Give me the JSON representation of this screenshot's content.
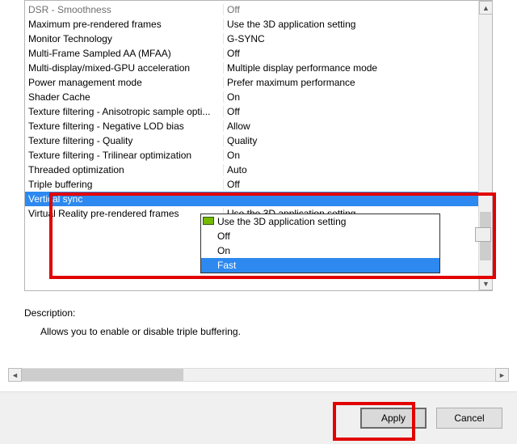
{
  "settings_grid": {
    "rows": [
      {
        "feature": "DSR - Smoothness",
        "value": "Off",
        "muted": true
      },
      {
        "feature": "Maximum pre-rendered frames",
        "value": "Use the 3D application setting"
      },
      {
        "feature": "Monitor Technology",
        "value": "G-SYNC"
      },
      {
        "feature": "Multi-Frame Sampled AA (MFAA)",
        "value": "Off"
      },
      {
        "feature": "Multi-display/mixed-GPU acceleration",
        "value": "Multiple display performance mode"
      },
      {
        "feature": "Power management mode",
        "value": "Prefer maximum performance"
      },
      {
        "feature": "Shader Cache",
        "value": "On"
      },
      {
        "feature": "Texture filtering - Anisotropic sample opti...",
        "value": "Off"
      },
      {
        "feature": "Texture filtering - Negative LOD bias",
        "value": "Allow"
      },
      {
        "feature": "Texture filtering - Quality",
        "value": "Quality"
      },
      {
        "feature": "Texture filtering - Trilinear optimization",
        "value": "On"
      },
      {
        "feature": "Threaded optimization",
        "value": "Auto"
      },
      {
        "feature": "Triple buffering",
        "value": "Off"
      },
      {
        "feature": "Vertical sync",
        "value": "Fast",
        "selected": true
      },
      {
        "feature": "Virtual Reality pre-rendered frames",
        "value": "Use the 3D application setting"
      }
    ]
  },
  "dropdown": {
    "selected": "Fast",
    "options": [
      {
        "label": "Use the 3D application setting",
        "nvidia_icon": true
      },
      {
        "label": "Off"
      },
      {
        "label": "On"
      },
      {
        "label": "Fast",
        "highlighted": true
      }
    ]
  },
  "description": {
    "label": "Description:",
    "text": "Allows you to enable or disable triple buffering."
  },
  "footer": {
    "apply_label": "Apply",
    "cancel_label": "Cancel"
  }
}
